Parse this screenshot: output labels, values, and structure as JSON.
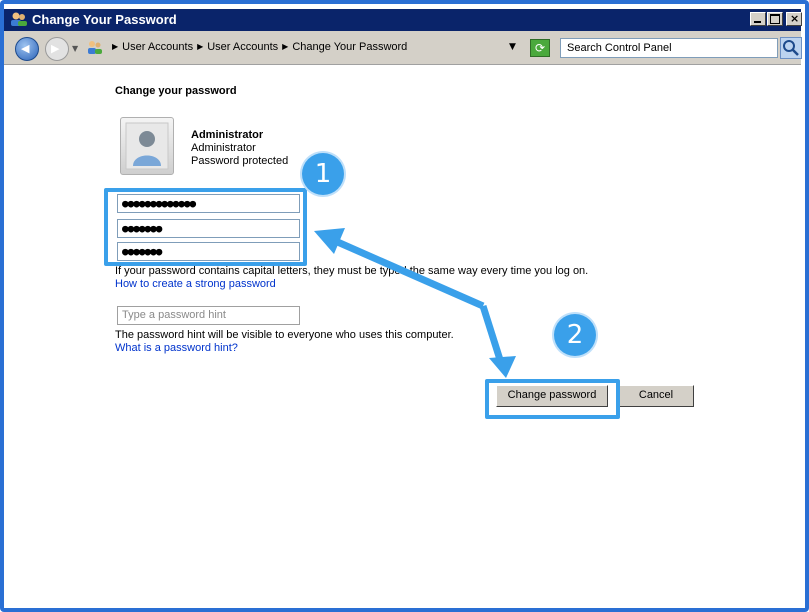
{
  "window": {
    "title": "Change Your Password"
  },
  "address": {
    "crumbs": [
      "User Accounts",
      "User Accounts",
      "Change Your Password"
    ],
    "search_placeholder": "Search Control Panel"
  },
  "page": {
    "heading": "Change your password",
    "user": {
      "name": "Administrator",
      "role": "Administrator",
      "status": "Password protected"
    },
    "current_password": "●●●●●●●●●●●●●",
    "new_password": "●●●●●●●",
    "confirm_password": "●●●●●●●",
    "caps_note": "If your password contains capital letters, they must be typed the same way every time you log on.",
    "strong_link": "How to create a strong password",
    "hint_placeholder": "Type a password hint",
    "hint_note": "The password hint will be visible to everyone who uses this computer.",
    "hint_link": "What is a password hint?",
    "change_button": "Change password",
    "cancel_button": "Cancel"
  },
  "annotations": {
    "step1": "1",
    "step2": "2",
    "color": "#3aa0ea"
  },
  "colors": {
    "window_frame": "#2a6fd4",
    "titlebar": "#0a246a",
    "link": "#0033cc",
    "chrome": "#d4d0c8"
  }
}
